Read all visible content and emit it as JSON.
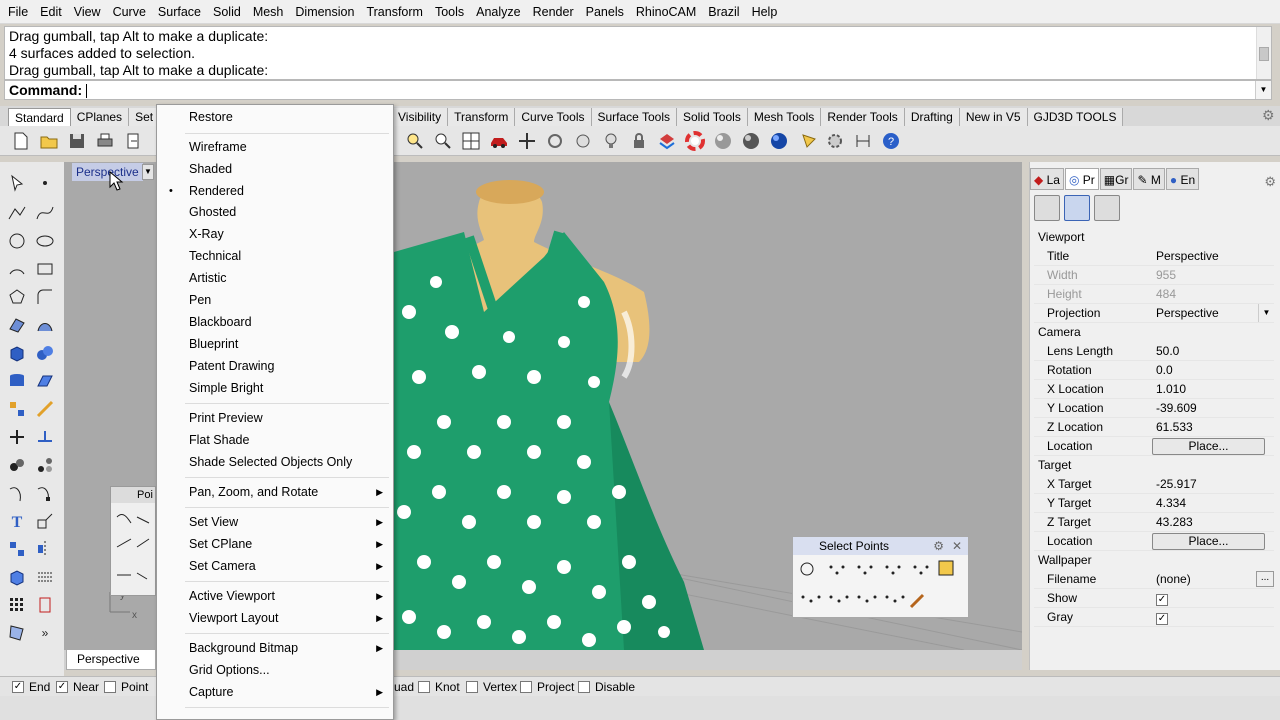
{
  "menubar": [
    "File",
    "Edit",
    "View",
    "Curve",
    "Surface",
    "Solid",
    "Mesh",
    "Dimension",
    "Transform",
    "Tools",
    "Analyze",
    "Render",
    "Panels",
    "RhinoCAM",
    "Brazil",
    "Help"
  ],
  "command": {
    "history": [
      "Drag gumball, tap Alt to make a duplicate:",
      "4 surfaces added to selection.",
      "Drag gumball, tap Alt to make a duplicate:"
    ],
    "prompt": "Command:"
  },
  "toolbar_tabs_left": [
    "Standard",
    "CPlanes",
    "Set"
  ],
  "toolbar_tabs_right": [
    "Visibility",
    "Transform",
    "Curve Tools",
    "Surface Tools",
    "Solid Tools",
    "Mesh Tools",
    "Render Tools",
    "Drafting",
    "New in V5",
    "GJD3D TOOLS"
  ],
  "viewport": {
    "title": "Perspective",
    "tab_label": "Perspective",
    "float_palette_title": "Poi"
  },
  "select_points": {
    "title": "Select Points"
  },
  "context_menu": {
    "items": [
      {
        "label": "Restore",
        "submenu": false
      },
      {
        "label": "Wireframe",
        "submenu": false
      },
      {
        "label": "Shaded",
        "submenu": false
      },
      {
        "label": "Rendered",
        "submenu": false,
        "checked": true
      },
      {
        "label": "Ghosted",
        "submenu": false
      },
      {
        "label": "X-Ray",
        "submenu": false
      },
      {
        "label": "Technical",
        "submenu": false
      },
      {
        "label": "Artistic",
        "submenu": false
      },
      {
        "label": "Pen",
        "submenu": false
      },
      {
        "label": "Blackboard",
        "submenu": false
      },
      {
        "label": "Blueprint",
        "submenu": false
      },
      {
        "label": "Patent Drawing",
        "submenu": false
      },
      {
        "label": "Simple Bright",
        "submenu": false
      },
      {
        "label": "Print Preview",
        "submenu": false
      },
      {
        "label": "Flat Shade",
        "submenu": false
      },
      {
        "label": "Shade Selected Objects Only",
        "submenu": false
      },
      {
        "label": "Pan, Zoom, and Rotate",
        "submenu": true
      },
      {
        "label": "Set View",
        "submenu": true
      },
      {
        "label": "Set CPlane",
        "submenu": true
      },
      {
        "label": "Set Camera",
        "submenu": true
      },
      {
        "label": "Active Viewport",
        "submenu": true
      },
      {
        "label": "Viewport Layout",
        "submenu": true
      },
      {
        "label": "Background Bitmap",
        "submenu": true
      },
      {
        "label": "Grid Options...",
        "submenu": false
      },
      {
        "label": "Capture",
        "submenu": true
      }
    ]
  },
  "right_panel": {
    "tabs": [
      "La",
      "Pr",
      "Gr",
      "M",
      "En"
    ],
    "sections": {
      "viewport": "Viewport",
      "camera": "Camera",
      "target": "Target",
      "wallpaper": "Wallpaper"
    },
    "props": {
      "title": {
        "key": "Title",
        "value": "Perspective"
      },
      "width": {
        "key": "Width",
        "value": "955"
      },
      "height": {
        "key": "Height",
        "value": "484"
      },
      "projection": {
        "key": "Projection",
        "value": "Perspective"
      },
      "lens_length": {
        "key": "Lens Length",
        "value": "50.0"
      },
      "rotation": {
        "key": "Rotation",
        "value": "0.0"
      },
      "x_location": {
        "key": "X Location",
        "value": "1.010"
      },
      "y_location": {
        "key": "Y Location",
        "value": "-39.609"
      },
      "z_location": {
        "key": "Z Location",
        "value": "61.533"
      },
      "cam_location": {
        "key": "Location",
        "value": "Place..."
      },
      "x_target": {
        "key": "X Target",
        "value": "-25.917"
      },
      "y_target": {
        "key": "Y Target",
        "value": "4.334"
      },
      "z_target": {
        "key": "Z Target",
        "value": "43.283"
      },
      "tgt_location": {
        "key": "Location",
        "value": "Place..."
      },
      "filename": {
        "key": "Filename",
        "value": "(none)"
      },
      "show": {
        "key": "Show",
        "checked": true
      },
      "gray": {
        "key": "Gray",
        "checked": true
      }
    }
  },
  "osnaps": [
    {
      "label": "End",
      "checked": true
    },
    {
      "label": "Near",
      "checked": true
    },
    {
      "label": "Point",
      "checked": false
    },
    {
      "label": "uad",
      "checked": false
    },
    {
      "label": "Knot",
      "checked": false
    },
    {
      "label": "Vertex",
      "checked": false
    },
    {
      "label": "Project",
      "checked": false
    },
    {
      "label": "Disable",
      "checked": false
    }
  ],
  "colors": {
    "dress": "#1e9e6c",
    "dots": "#ffffff",
    "mannequin": "#e8c27a",
    "viewport_bg": "#a9a9a9"
  }
}
